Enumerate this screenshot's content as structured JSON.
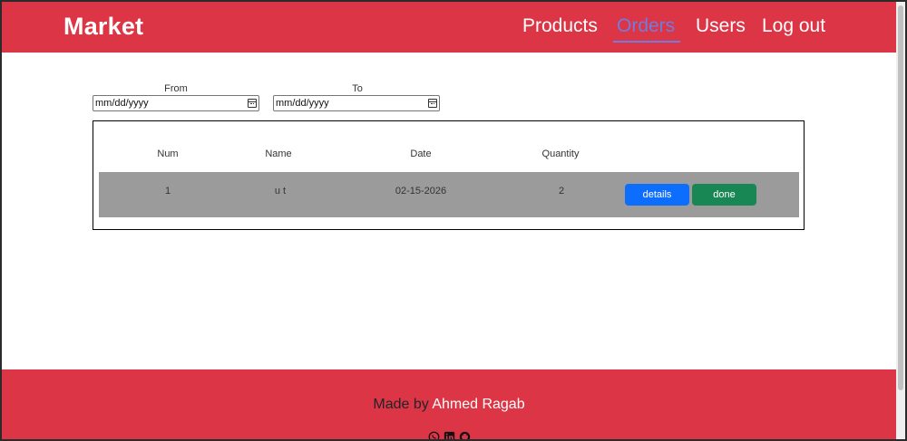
{
  "navbar": {
    "brand": "Market",
    "links": [
      {
        "label": "Products",
        "active": false
      },
      {
        "label": "Orders",
        "active": true
      },
      {
        "label": "Users",
        "active": false
      },
      {
        "label": "Log out",
        "active": false
      }
    ],
    "active_color": "#6f7ce0",
    "bg_color": "#dc3545"
  },
  "filters": {
    "from_label": "From",
    "from_placeholder": "mm/dd/yyyy",
    "to_label": "To",
    "to_placeholder": "mm/dd/yyyy"
  },
  "orders_table": {
    "headers": [
      "Num",
      "Name",
      "Date",
      "Quantity"
    ],
    "rows": [
      {
        "num": "1",
        "name": "u t",
        "date": "02-15-2026",
        "quantity": "2",
        "details_label": "details",
        "done_label": "done"
      }
    ]
  },
  "footer": {
    "credit_prefix": "Made by",
    "author": "Ahmed Ragab",
    "social_icons": [
      "whatsapp-icon",
      "linkedin-icon",
      "github-icon"
    ]
  }
}
